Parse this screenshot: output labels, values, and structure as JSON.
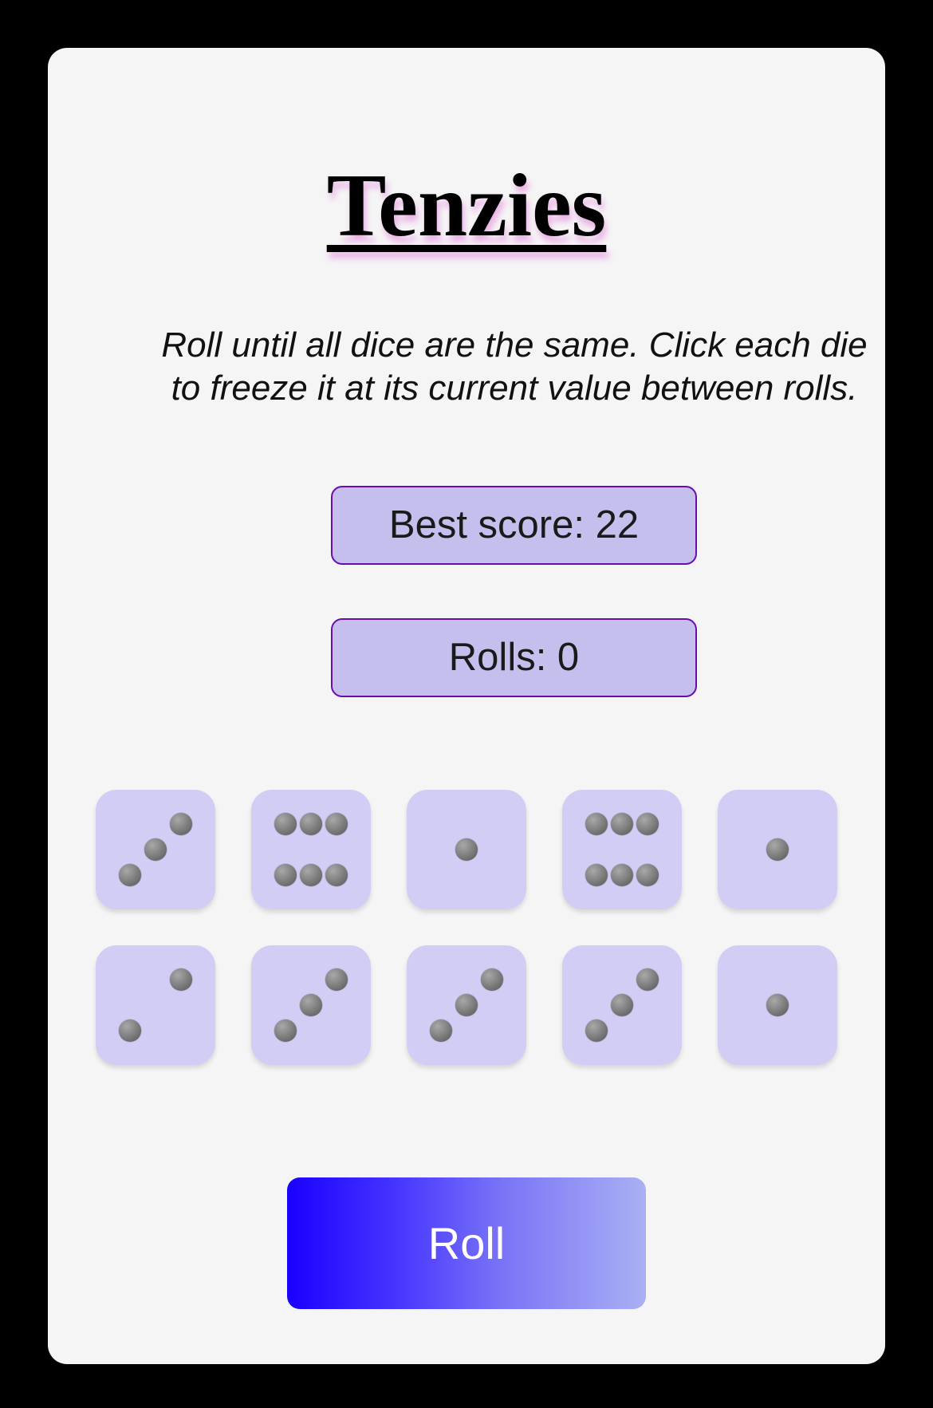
{
  "title": "Tenzies",
  "instructions": "Roll until all dice are the same. Click each die to freeze it at its current value between rolls.",
  "best_score": "Best score: 22",
  "rolls": "Rolls: 0",
  "dice": [
    3,
    6,
    1,
    6,
    1,
    2,
    3,
    3,
    3,
    1
  ],
  "roll_button": "Roll",
  "colors": {
    "die": "#d2cdf5",
    "stat_bg": "#c4bfec",
    "stat_border": "#6a0dad",
    "button_start": "#1a00ff",
    "button_end": "#aab0f4"
  }
}
